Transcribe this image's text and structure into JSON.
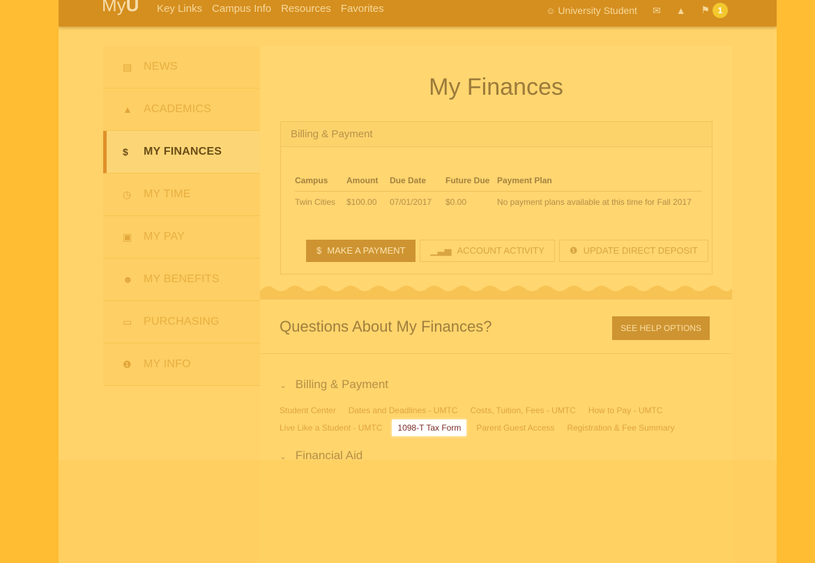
{
  "topbar": {
    "brand_prefix": "My",
    "brand_suffix": "U",
    "nav": [
      "Key Links",
      "Campus Info",
      "Resources",
      "Favorites"
    ],
    "user_label": "University Student",
    "notification_count": "1"
  },
  "sidebar": {
    "items": [
      {
        "label": "NEWS",
        "icon": "newspaper-icon"
      },
      {
        "label": "ACADEMICS",
        "icon": "graduation-cap-icon"
      },
      {
        "label": "MY FINANCES",
        "icon": "dollar-icon",
        "active": true
      },
      {
        "label": "MY TIME",
        "icon": "clock-icon"
      },
      {
        "label": "MY PAY",
        "icon": "money-icon"
      },
      {
        "label": "MY BENEFITS",
        "icon": "user-plus-icon"
      },
      {
        "label": "PURCHASING",
        "icon": "credit-card-icon"
      },
      {
        "label": "MY INFO",
        "icon": "info-icon"
      }
    ]
  },
  "main": {
    "title": "My Finances",
    "billing": {
      "heading": "Billing & Payment",
      "columns": [
        "Campus",
        "Amount",
        "Due Date",
        "Future Due",
        "Payment Plan"
      ],
      "row": [
        "Twin Cities",
        "$100.00",
        "07/01/2017",
        "$0.00",
        "No payment plans available at this time for Fall 2017"
      ],
      "buttons": {
        "make_payment": "MAKE A PAYMENT",
        "account_activity": "ACCOUNT ACTIVITY",
        "update_deposit": "UPDATE DIRECT DEPOSIT"
      }
    },
    "questions": {
      "title": "Questions About My Finances?",
      "help_button": "SEE HELP OPTIONS",
      "section_billing": "Billing & Payment",
      "links_line1": [
        "Student Center",
        "Dates and Deadlines - UMTC",
        "Costs, Tuition, Fees - UMTC",
        "How to Pay - UMTC"
      ],
      "links_line2_before": "Live Like a Student - UMTC",
      "links_line2_highlight": "1098-T Tax Form",
      "links_line2_after": [
        "Parent Guest Access",
        "Registration & Fee Summary"
      ],
      "section_aid": "Financial Aid"
    }
  },
  "colors": {
    "overlay": "#FFD36A",
    "topbar": "#D58F1F",
    "primary_button": "#CE9431",
    "highlight_link": "#7A2A24"
  }
}
